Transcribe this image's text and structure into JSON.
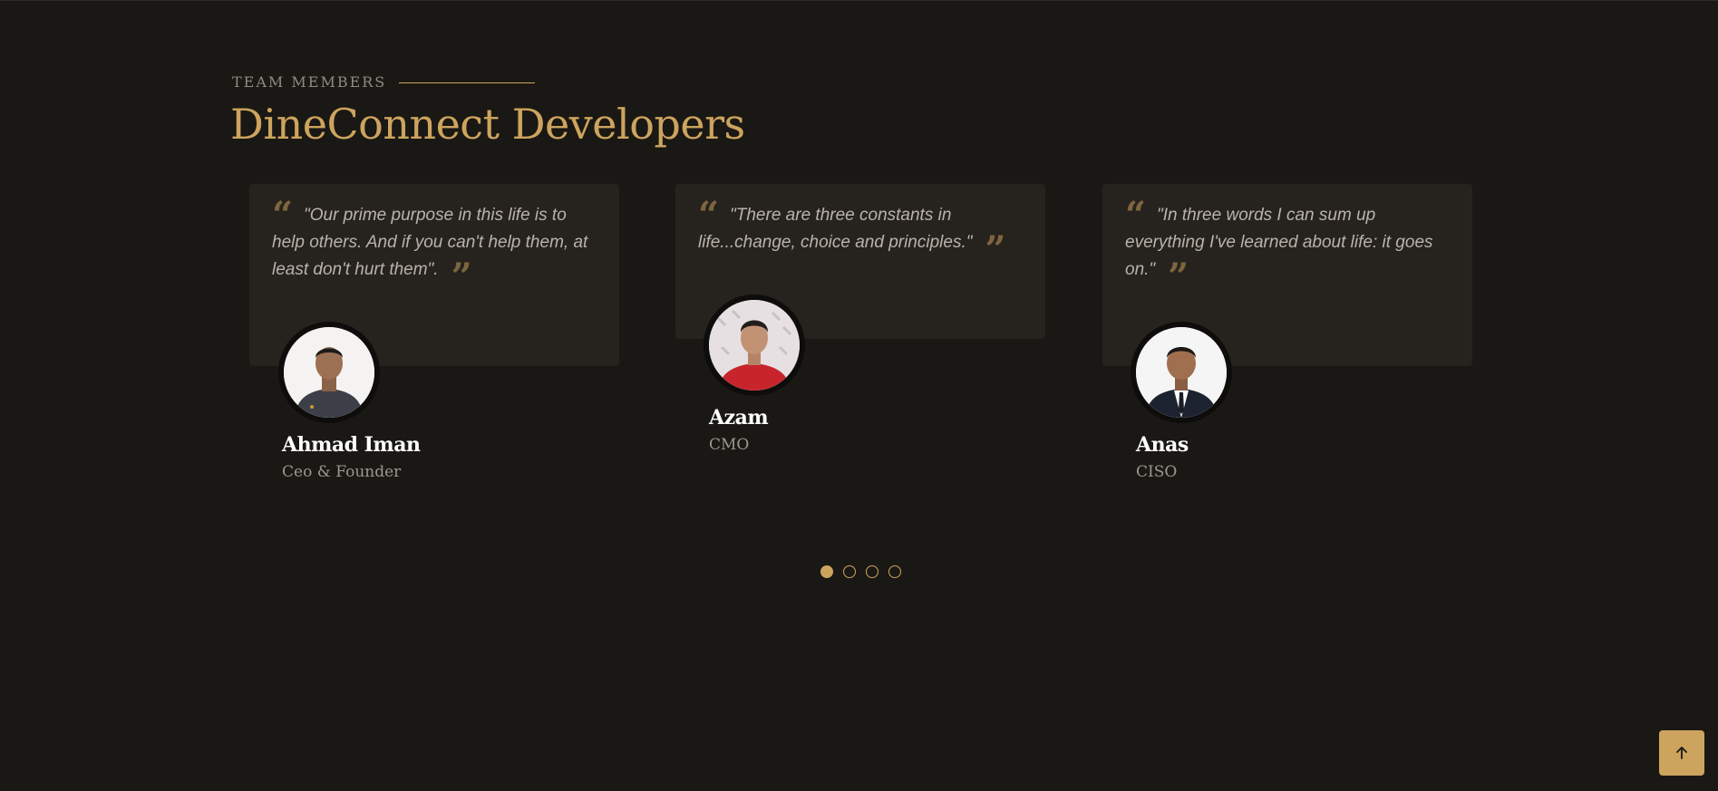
{
  "section": {
    "eyebrow": "TEAM MEMBERS",
    "title": "DineConnect Developers"
  },
  "members": [
    {
      "quote": "\"Our prime purpose in this life is to help others. And if you can't help them, at least don't hurt them\".",
      "name": "Ahmad Iman",
      "role": "Ceo & Founder",
      "avatar_icon": "person-photo"
    },
    {
      "quote": "\"There are three constants in life...change, choice and principles.\"",
      "name": "Azam",
      "role": "CMO",
      "avatar_icon": "person-photo"
    },
    {
      "quote": "\"In three words I can sum up everything I've learned about life: it goes on.\"",
      "name": "Anas",
      "role": "CISO",
      "avatar_icon": "person-photo"
    }
  ],
  "pagination": {
    "pages": 4,
    "active_page": 1
  },
  "back_to_top": {
    "icon": "arrow-up-icon"
  },
  "colors": {
    "background": "#1a1814",
    "card": "#26221d",
    "accent": "#cda45e",
    "quote_mark": "#7d6540",
    "text_muted": "#b8b4ac"
  }
}
